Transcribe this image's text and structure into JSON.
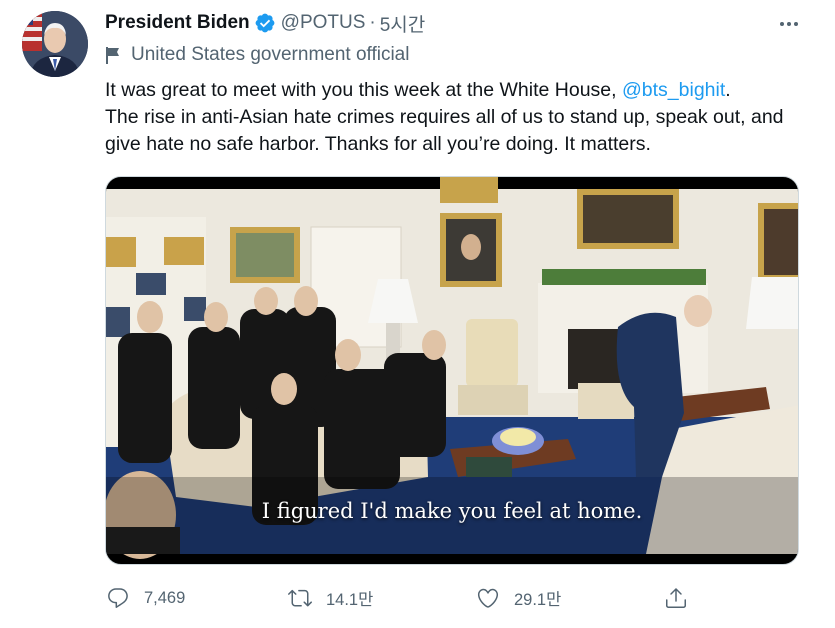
{
  "tweet": {
    "author_name": "President Biden",
    "handle": "@POTUS",
    "separator": "·",
    "time": "5시간",
    "label": "United States government official",
    "text_line1_pre": "It was great to meet with you this week at the White House, ",
    "mention": "@bts_bighit",
    "text_line1_post": ".",
    "text_rest": "The rise in anti-Asian hate crimes requires all of us to stand up, speak out, and give hate no safe harbor. Thanks for all you’re doing. It matters.",
    "media_caption": "I figured I'd make you feel at home."
  },
  "actions": {
    "replies": "7,469",
    "retweets": "14.1만",
    "likes": "29.1만"
  },
  "icons": {
    "verified": "verified-badge-icon",
    "more": "more-options-icon",
    "label": "government-flag-icon",
    "reply": "reply-icon",
    "retweet": "retweet-icon",
    "like": "heart-icon",
    "share": "share-icon"
  },
  "colors": {
    "accent": "#1d9bf0",
    "secondary_text": "#536471",
    "primary_text": "#0f1419"
  }
}
